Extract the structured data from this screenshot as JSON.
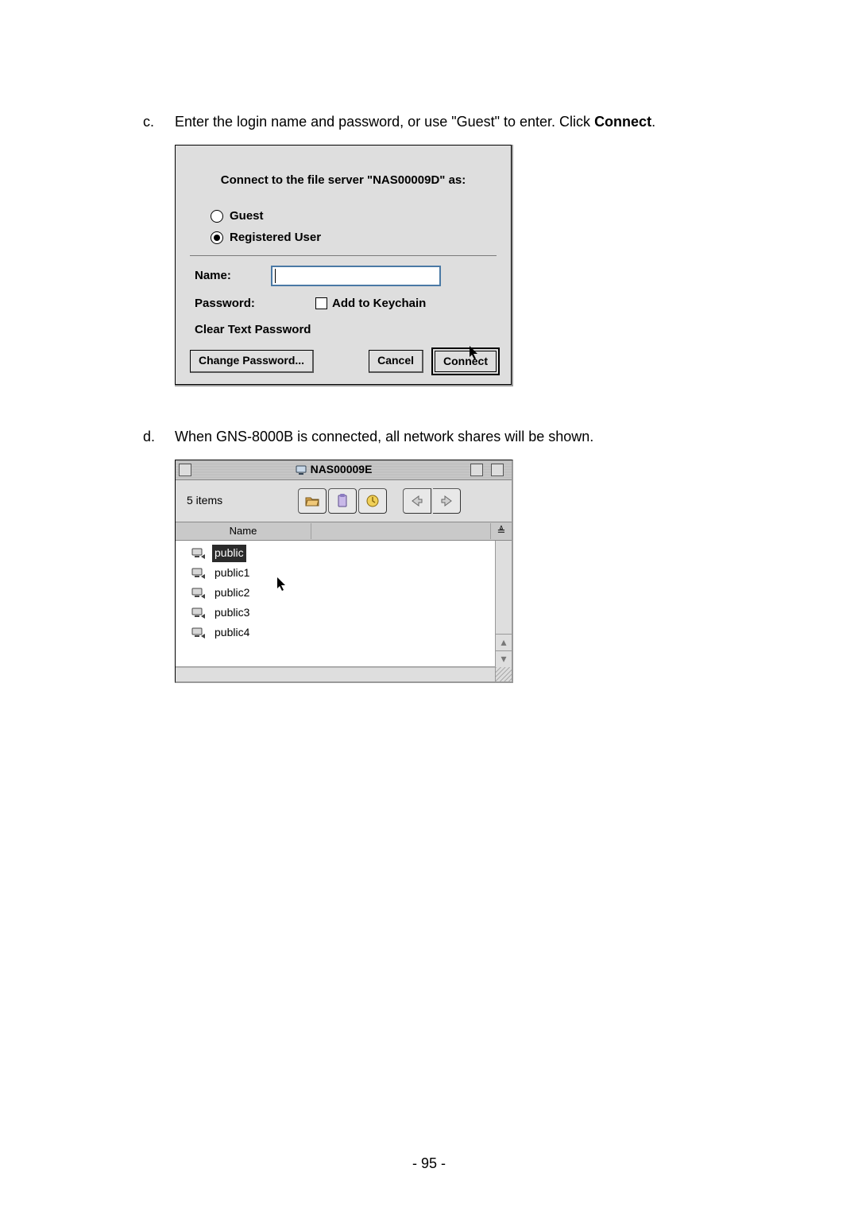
{
  "step_c": {
    "marker": "c.",
    "text_before": "Enter the login name and password, or use \"Guest\" to enter.  Click ",
    "bold_word": "Connect",
    "text_after": "."
  },
  "dialog1": {
    "title": "Connect to the file server \"NAS00009D\" as:",
    "guest_label": "Guest",
    "registered_label": "Registered User",
    "name_label": "Name:",
    "password_label": "Password:",
    "keychain_label": "Add to Keychain",
    "cleartext_label": "Clear Text Password",
    "change_pw_btn": "Change Password...",
    "cancel_btn": "Cancel",
    "connect_btn": "Connect"
  },
  "step_d": {
    "marker": "d.",
    "text": "When GNS-8000B is connected, all network shares will be shown."
  },
  "dialog2": {
    "title": "NAS00009E",
    "item_count": "5 items",
    "col_name": "Name",
    "sort_glyph": "≜",
    "shares": [
      "public",
      "public1",
      "public2",
      "public3",
      "public4"
    ],
    "scroll_up": "▴",
    "scroll_down": "▾"
  },
  "footer": "- 95 -"
}
